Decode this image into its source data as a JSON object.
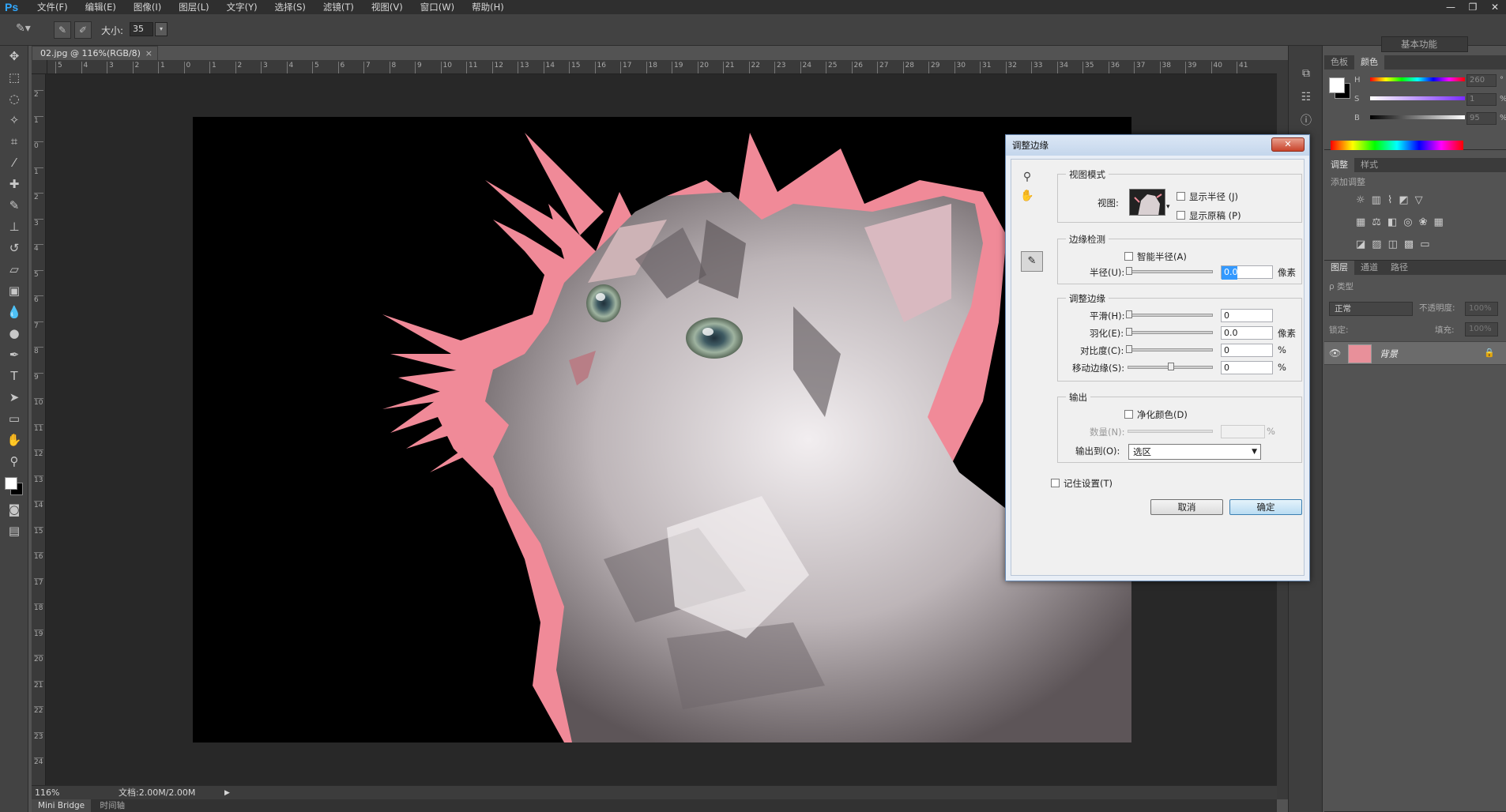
{
  "app": {
    "logo": "Ps"
  },
  "menu": [
    "文件(F)",
    "编辑(E)",
    "图像(I)",
    "图层(L)",
    "文字(Y)",
    "选择(S)",
    "滤镜(T)",
    "视图(V)",
    "窗口(W)",
    "帮助(H)"
  ],
  "window_controls": {
    "minimize": "—",
    "restore": "❐",
    "close": "✕"
  },
  "options": {
    "size_label": "大小:",
    "size_value": "35",
    "workspace": "基本功能"
  },
  "document": {
    "tab_title": "02.jpg @ 116%(RGB/8)",
    "close": "×"
  },
  "status": {
    "zoom": "116%",
    "doc": "文档:2.00M/2.00M",
    "arrow": "▶"
  },
  "bottom_tabs": [
    "Mini Bridge",
    "时间轴"
  ],
  "ruler_top": [
    "5",
    "4",
    "3",
    "2",
    "1",
    "0",
    "1",
    "2",
    "3",
    "4",
    "5",
    "6",
    "7",
    "8",
    "9",
    "10",
    "11",
    "12",
    "13",
    "14",
    "15",
    "16",
    "17",
    "18",
    "19",
    "20",
    "21",
    "22",
    "23",
    "24",
    "25",
    "26",
    "27",
    "28",
    "29",
    "30",
    "31",
    "32",
    "33",
    "34",
    "35",
    "36",
    "37",
    "38",
    "39",
    "40",
    "41"
  ],
  "ruler_left": [
    "2",
    "1",
    "0",
    "1",
    "2",
    "3",
    "4",
    "5",
    "6",
    "7",
    "8",
    "9",
    "10",
    "11",
    "12",
    "13",
    "14",
    "15",
    "16",
    "17",
    "18",
    "19",
    "20",
    "21",
    "22",
    "23",
    "24"
  ],
  "color_panel": {
    "tabs": [
      "色板",
      "颜色"
    ],
    "rows": [
      {
        "label": "H",
        "value": "260",
        "unit": "°"
      },
      {
        "label": "S",
        "value": "1",
        "unit": "%"
      },
      {
        "label": "B",
        "value": "95",
        "unit": "%"
      }
    ]
  },
  "adjust_panel": {
    "tabs": [
      "调整",
      "样式"
    ],
    "add_label": "添加调整"
  },
  "layers_panel": {
    "tabs": [
      "图层",
      "通道",
      "路径"
    ],
    "kind": "ρ 类型",
    "blend": "正常",
    "opacity_label": "不透明度:",
    "opacity_value": "100%",
    "lock_label": "锁定:",
    "fill_label": "填充:",
    "fill_value": "100%",
    "layer_name": "背景"
  },
  "dialog": {
    "title": "调整边缘",
    "close": "✕",
    "view_mode": {
      "title": "视图模式",
      "view_label": "视图:",
      "show_radius": "显示半径 (J)",
      "show_original": "显示原稿 (P)"
    },
    "edge_detection": {
      "title": "边缘检测",
      "smart_radius": "智能半径(A)",
      "radius_label": "半径(U):",
      "radius_value": "0.0",
      "radius_unit": "像素"
    },
    "adjust_edge": {
      "title": "调整边缘",
      "smooth_label": "平滑(H):",
      "smooth_value": "0",
      "feather_label": "羽化(E):",
      "feather_value": "0.0",
      "feather_unit": "像素",
      "contrast_label": "对比度(C):",
      "contrast_value": "0",
      "contrast_unit": "%",
      "shift_label": "移动边缘(S):",
      "shift_value": "0",
      "shift_unit": "%"
    },
    "output": {
      "title": "输出",
      "decontaminate": "净化颜色(D)",
      "amount_label": "数量(N):",
      "amount_unit": "%",
      "output_to_label": "输出到(O):",
      "output_to_value": "选区"
    },
    "remember": "记住设置(T)",
    "cancel": "取消",
    "ok": "确定"
  }
}
